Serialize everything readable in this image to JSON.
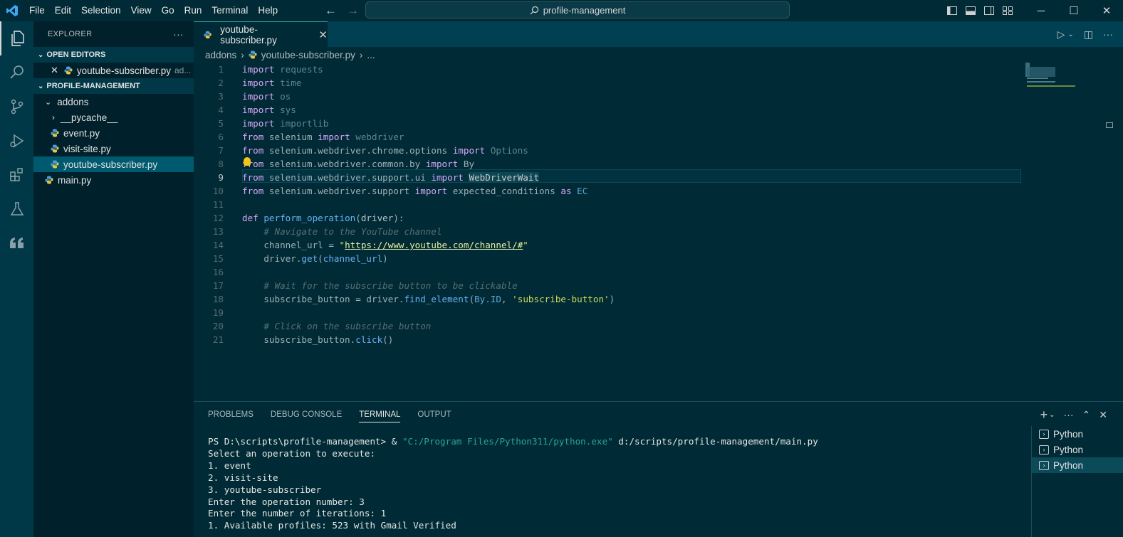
{
  "menu": [
    "File",
    "Edit",
    "Selection",
    "View",
    "Go",
    "Run",
    "Terminal",
    "Help"
  ],
  "search": {
    "label": "profile-management"
  },
  "sidebar": {
    "title": "EXPLORER",
    "open_editors_label": "OPEN EDITORS",
    "open_editor_file": "youtube-subscriber.py",
    "open_editor_dir": "ad...",
    "project_label": "PROFILE-MANAGEMENT",
    "folder": "addons",
    "subfolder": "__pycache__",
    "files": [
      "event.py",
      "visit-site.py",
      "youtube-subscriber.py"
    ],
    "root_file": "main.py"
  },
  "tab": {
    "label": "youtube-subscriber.py"
  },
  "breadcrumb": {
    "folder": "addons",
    "file": "youtube-subscriber.py",
    "more": "..."
  },
  "code": {
    "line_numbers": [
      "1",
      "2",
      "3",
      "4",
      "5",
      "6",
      "7",
      "8",
      "9",
      "10",
      "11",
      "12",
      "13",
      "14",
      "15",
      "16",
      "17",
      "18",
      "19",
      "20",
      "21"
    ],
    "lines": [
      [
        [
          "kw",
          "import"
        ],
        [
          "id",
          " "
        ],
        [
          "mod",
          "requests"
        ]
      ],
      [
        [
          "kw",
          "import"
        ],
        [
          "id",
          " "
        ],
        [
          "mod",
          "time"
        ]
      ],
      [
        [
          "kw",
          "import"
        ],
        [
          "id",
          " "
        ],
        [
          "mod",
          "os"
        ]
      ],
      [
        [
          "kw",
          "import"
        ],
        [
          "id",
          " "
        ],
        [
          "mod",
          "sys"
        ]
      ],
      [
        [
          "kw",
          "import"
        ],
        [
          "id",
          " "
        ],
        [
          "mod",
          "importlib"
        ]
      ],
      [
        [
          "kw",
          "from"
        ],
        [
          "id",
          " selenium "
        ],
        [
          "kw",
          "import"
        ],
        [
          "id",
          " "
        ],
        [
          "mod",
          "webdriver"
        ]
      ],
      [
        [
          "kw",
          "from"
        ],
        [
          "id",
          " selenium.webdriver.chrome.options "
        ],
        [
          "kw",
          "import"
        ],
        [
          "id",
          " "
        ],
        [
          "mod",
          "Options"
        ]
      ],
      [
        [
          "kw",
          "from"
        ],
        [
          "id",
          " selenium.webdriver.common.by "
        ],
        [
          "kw",
          "import"
        ],
        [
          "id",
          " By"
        ]
      ],
      [
        [
          "kw",
          "from"
        ],
        [
          "id",
          " selenium.webdriver.support.ui "
        ],
        [
          "kw",
          "import"
        ],
        [
          "id",
          " "
        ],
        [
          "hl",
          "WebDriverWait"
        ]
      ],
      [
        [
          "kw",
          "from"
        ],
        [
          "id",
          " selenium.webdriver.support "
        ],
        [
          "kw",
          "import"
        ],
        [
          "id",
          " expected_conditions "
        ],
        [
          "kw",
          "as"
        ],
        [
          "id",
          " "
        ],
        [
          "cls",
          "EC"
        ]
      ],
      [],
      [
        [
          "kw",
          "def"
        ],
        [
          "id",
          " "
        ],
        [
          "fn",
          "perform_operation"
        ],
        [
          "id",
          "("
        ],
        [
          "param",
          "driver"
        ],
        [
          "id",
          "):"
        ]
      ],
      [
        [
          "id",
          "    "
        ],
        [
          "cmt",
          "# Navigate to the YouTube channel"
        ]
      ],
      [
        [
          "id",
          "    channel_url = "
        ],
        [
          "str",
          "\""
        ],
        [
          "url",
          "https://www.youtube.com/channel/#"
        ],
        [
          "str",
          "\""
        ]
      ],
      [
        [
          "id",
          "    driver."
        ],
        [
          "fn",
          "get"
        ],
        [
          "id",
          "("
        ],
        [
          "fn",
          "channel_url"
        ],
        [
          "id",
          ")"
        ]
      ],
      [],
      [
        [
          "id",
          "    "
        ],
        [
          "cmt",
          "# Wait for the subscribe button to be clickable"
        ]
      ],
      [
        [
          "id",
          "    subscribe_button = driver."
        ],
        [
          "fn",
          "find_element"
        ],
        [
          "id",
          "("
        ],
        [
          "cls",
          "By.ID"
        ],
        [
          "id",
          ", "
        ],
        [
          "str",
          "'subscribe-button'"
        ],
        [
          "id",
          ")"
        ]
      ],
      [],
      [
        [
          "id",
          "    "
        ],
        [
          "cmt",
          "# Click on the subscribe button"
        ]
      ],
      [
        [
          "id",
          "    subscribe_button."
        ],
        [
          "fn",
          "click"
        ],
        [
          "id",
          "()"
        ]
      ]
    ]
  },
  "panel": {
    "tabs": [
      "PROBLEMS",
      "DEBUG CONSOLE",
      "TERMINAL",
      "OUTPUT"
    ],
    "active_tab": "TERMINAL",
    "terminal": {
      "prompt": "PS D:\\scripts\\profile-management> & ",
      "exe": "\"C:/Program Files/Python311/python.exe\"",
      "script": " d:/scripts/profile-management/main.py",
      "output": [
        "Select an operation to execute:",
        "1. event",
        "2. visit-site",
        "3. youtube-subscriber",
        "Enter the operation number: 3",
        "Enter the number of iterations: 1",
        "1. Available profiles: 523 with Gmail Verified"
      ]
    },
    "terminals": [
      "Python",
      "Python",
      "Python"
    ]
  },
  "colors": {
    "background": "#002b36",
    "accent": "#2aa198",
    "keyword": "#d7a6f7"
  }
}
